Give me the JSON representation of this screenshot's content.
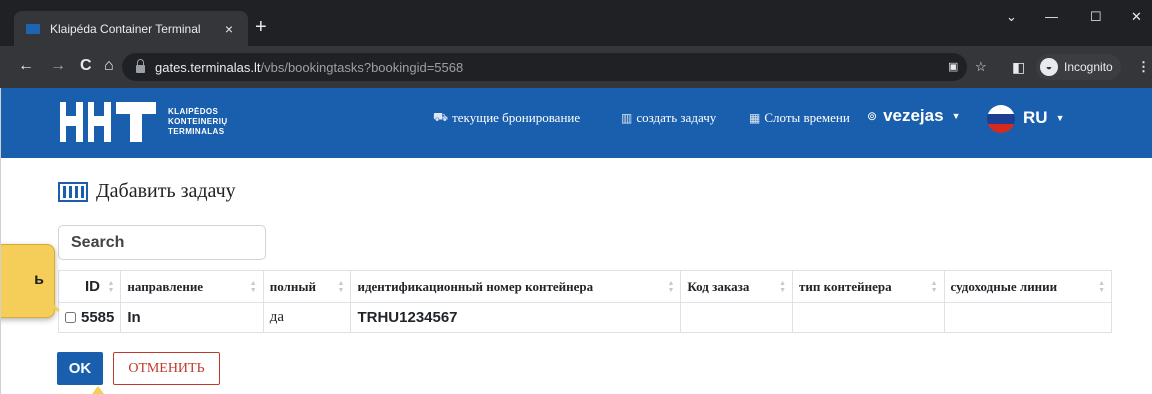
{
  "browser": {
    "tab_title": "Klaipéda Container Terminal",
    "tab_close": "×",
    "new_tab": "+",
    "url_host": "gates.terminalas.lt",
    "url_path": "/vbs/bookingtasks?bookingid=5568",
    "incognito_label": "Incognito",
    "window_controls": {
      "dropdown": "⌄",
      "minimize": "—",
      "maximize": "☐",
      "close": "✕"
    }
  },
  "header": {
    "logo_lines": [
      "KLAIPĖDOS",
      "KONTEINERIŲ",
      "TERMINALAS"
    ],
    "nav": [
      {
        "icon": "truck-icon",
        "glyph": "⛟",
        "label": "текущие бронирование"
      },
      {
        "icon": "container-icon",
        "glyph": "▥",
        "label": "создать задачу"
      },
      {
        "icon": "calendar-icon",
        "glyph": "▦",
        "label": "Слоты времени"
      }
    ],
    "user_icon": "⊚",
    "user": "vezejas",
    "language": "RU",
    "flag_colors": [
      "#ffffff",
      "#1c3f94",
      "#d52b1e"
    ],
    "accent_color": "#1a5fad"
  },
  "page": {
    "title": "Дабавить задачу",
    "search_placeholder": "Search"
  },
  "table": {
    "columns": [
      "ID",
      "направление",
      "полный",
      "идентификационный номер контейнера",
      "Код заказа",
      "тип контейнера",
      "судоходные линии"
    ],
    "rows": [
      {
        "id": "5585",
        "direction": "In",
        "full": "да",
        "container": "TRHU1234567",
        "order_code": "",
        "container_type": "",
        "shipping_line": ""
      }
    ]
  },
  "actions": {
    "ok": "OK",
    "cancel": "ОТМЕНИТЬ"
  },
  "annotation": {
    "callout_text": "ь"
  }
}
